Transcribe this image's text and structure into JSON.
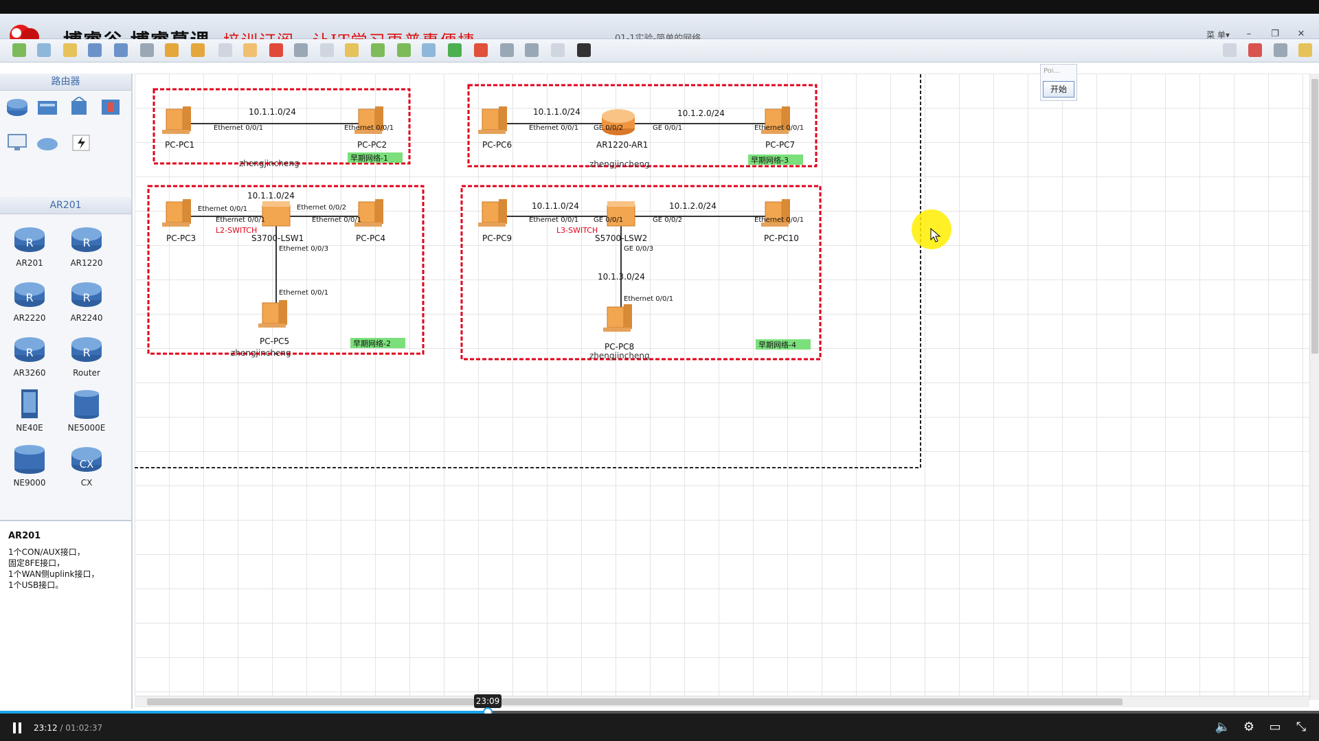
{
  "header": {
    "brand": "博睿谷·博睿慕课",
    "slogan": "培训订阅，让IT学习更普惠便捷",
    "window_title": "01-1实验-简单的网络",
    "menu_label": "菜 单▾",
    "minimize": "–",
    "restore": "❐",
    "close": "✕"
  },
  "left_panel": {
    "category_title": "路由器",
    "subcategory_title": "AR201",
    "devices": [
      {
        "label": "AR201"
      },
      {
        "label": "AR1220"
      },
      {
        "label": "AR2220"
      },
      {
        "label": "AR2240"
      },
      {
        "label": "AR3260"
      },
      {
        "label": "Router"
      },
      {
        "label": "NE40E"
      },
      {
        "label": "NE5000E"
      },
      {
        "label": "NE9000"
      },
      {
        "label": "CX"
      }
    ],
    "description_title": "AR201",
    "description_lines": [
      "1个CON/AUX接口，",
      "固定8FE接口，",
      "1个WAN侧uplink接口，",
      "1个USB接口。"
    ]
  },
  "topology": {
    "box1": {
      "subnet": "10.1.1.0/24",
      "pc_left": "PC-PC1",
      "pc_right": "PC-PC2",
      "port_left": "Ethernet 0/0/1",
      "port_right": "Ethernet 0/0/1",
      "author": "zhengjincheng",
      "tag": "早期网络-1"
    },
    "box2": {
      "subnet_left": "10.1.1.0/24",
      "subnet_right": "10.1.2.0/24",
      "pc_left": "PC-PC6",
      "router": "AR1220-AR1",
      "pc_right": "PC-PC7",
      "port_pc_left": "Ethernet 0/0/1",
      "port_r_left": "GE 0/0/2",
      "port_r_right": "GE 0/0/1",
      "port_pc_right": "Ethernet 0/0/1",
      "author": "zhengjincheng",
      "tag": "早期网络-3"
    },
    "box3": {
      "subnet": "10.1.1.0/24",
      "pc_left": "PC-PC3",
      "switch": "S3700-LSW1",
      "pc_right": "PC-PC4",
      "pc_bottom": "PC-PC5",
      "switch_note": "L2-SWITCH",
      "port_pc3": "Ethernet 0/0/1",
      "port_sw_left": "Ethernet 0/0/1",
      "port_sw_right": "Ethernet 0/0/2",
      "port_pc4": "Ethernet 0/0/1",
      "port_sw_down": "Ethernet 0/0/3",
      "port_pc5": "Ethernet 0/0/1",
      "author": "zhengjincheng",
      "tag": "早期网络-2"
    },
    "box4": {
      "subnet_left": "10.1.1.0/24",
      "subnet_right": "10.1.2.0/24",
      "subnet_down": "10.1.3.0/24",
      "pc_left": "PC-PC9",
      "switch": "S5700-LSW2",
      "pc_right": "PC-PC10",
      "pc_bottom": "PC-PC8",
      "switch_note": "L3-SWITCH",
      "port_pc9": "Ethernet 0/0/1",
      "port_sw_left": "GE 0/0/1",
      "port_sw_right": "GE 0/0/2",
      "port_pc10": "Ethernet 0/0/1",
      "port_sw_down": "GE 0/0/3",
      "port_pc8": "Ethernet 0/0/1",
      "author": "zhengjincheng",
      "tag": "早期网络-4"
    }
  },
  "popup": {
    "small_label": "Poi...",
    "start_button": "开始"
  },
  "player": {
    "current_time": "23:12",
    "separator": " / ",
    "total_time": "01:02:37",
    "hover_time": "23:09",
    "progress": 0.37
  },
  "colors": {
    "accent": "#1aa2ea",
    "frame_red": "#e0001a",
    "tag_green": "#7be07b"
  }
}
